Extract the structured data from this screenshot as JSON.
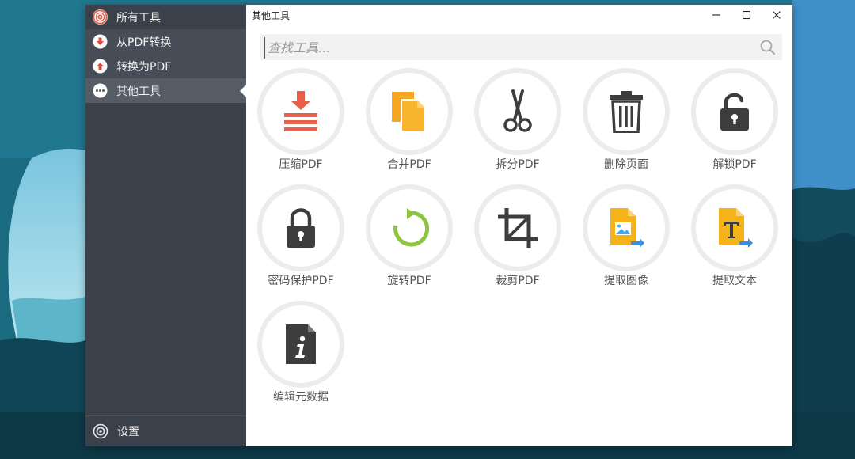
{
  "sidebar": {
    "items": [
      {
        "label": "所有工具",
        "icon": "spiral-icon",
        "icon_color": "#e9604a"
      },
      {
        "label": "从PDF转换",
        "icon": "arrow-down-circle-icon",
        "icon_color": "#e24a3b"
      },
      {
        "label": "转换为PDF",
        "icon": "arrow-up-circle-icon",
        "icon_color": "#e24a3b"
      },
      {
        "label": "其他工具",
        "icon": "more-dots-icon",
        "icon_color": "#ffffff"
      }
    ],
    "settings_label": "设置"
  },
  "window": {
    "title": "其他工具",
    "controls": [
      "minimize-icon",
      "maximize-icon",
      "close-icon"
    ]
  },
  "search": {
    "placeholder": "查找工具...",
    "value": ""
  },
  "tools": [
    {
      "label": "压缩PDF",
      "icon": "compress-icon",
      "color": "#e8604c"
    },
    {
      "label": "合并PDF",
      "icon": "merge-pages-icon",
      "color": "#f5a623"
    },
    {
      "label": "拆分PDF",
      "icon": "scissors-icon",
      "color": "#3d3d3d"
    },
    {
      "label": "删除页面",
      "icon": "trash-icon",
      "color": "#3d3d3d"
    },
    {
      "label": "解锁PDF",
      "icon": "unlock-icon",
      "color": "#3d3d3d"
    },
    {
      "label": "密码保护PDF",
      "icon": "lock-icon",
      "color": "#3d3d3d"
    },
    {
      "label": "旋转PDF",
      "icon": "rotate-icon",
      "color": "#8cc63f"
    },
    {
      "label": "裁剪PDF",
      "icon": "crop-icon",
      "color": "#3d3d3d"
    },
    {
      "label": "提取图像",
      "icon": "extract-image-icon",
      "color": "#f5b31a"
    },
    {
      "label": "提取文本",
      "icon": "extract-text-icon",
      "color": "#f5b31a"
    },
    {
      "label": "编辑元数据",
      "icon": "info-document-icon",
      "color": "#3d3d3d"
    }
  ],
  "colors": {
    "sidebar_bg": "#3a414a",
    "sidebar_active": "#565d66",
    "accent_red": "#e24a3b",
    "ring_gray": "#ececec"
  }
}
